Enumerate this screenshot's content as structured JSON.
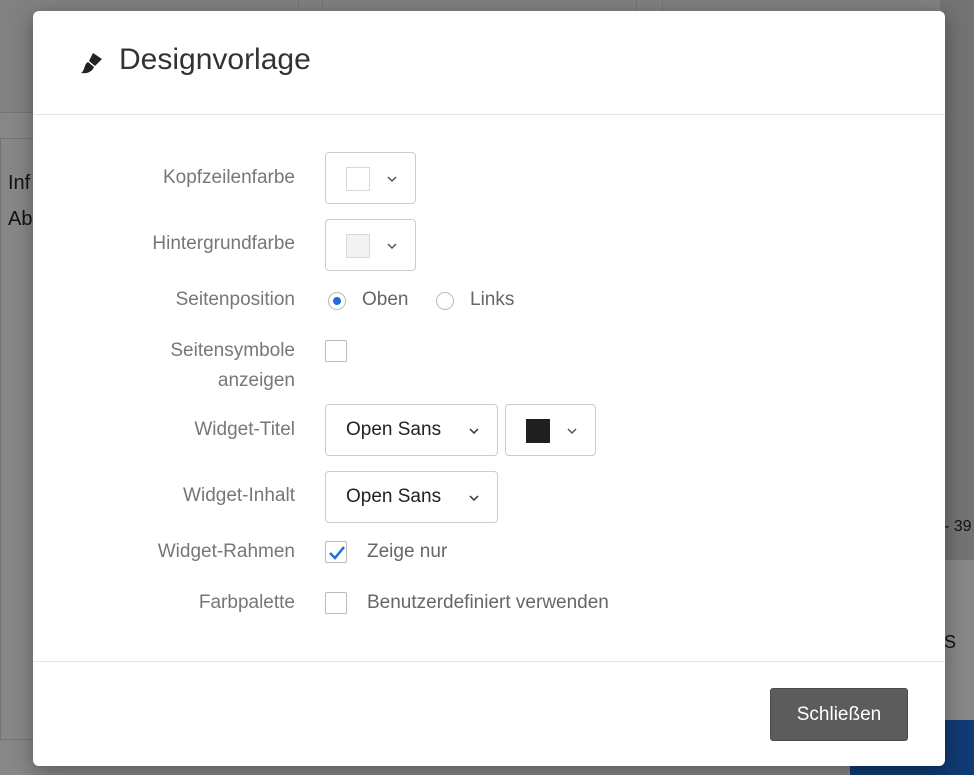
{
  "background": {
    "text_line_1": "Inf",
    "text_line_2": "Ab",
    "axis_fragment": "- 39",
    "icon_fragment": "S"
  },
  "modal": {
    "title": "Designvorlage",
    "icon": "brush-icon",
    "fields": {
      "header_color_label": "Kopfzeilenfarbe",
      "background_color_label": "Hintergrundfarbe",
      "page_position_label": "Seitenposition",
      "page_icons_label_1": "Seitensymbole",
      "page_icons_label_2": "anzeigen",
      "widget_title_label": "Widget-Titel",
      "widget_content_label": "Widget-Inhalt",
      "widget_frame_label": "Widget-Rahmen",
      "color_palette_label": "Farbpalette"
    },
    "values": {
      "header_color": "#ffffff",
      "background_color": "#f2f2f2",
      "page_position_options": [
        "Oben",
        "Links"
      ],
      "page_position_selected": "Oben",
      "page_icons_checked": false,
      "widget_title_font": "Open Sans",
      "widget_title_color": "#1f1f1f",
      "widget_content_font": "Open Sans",
      "widget_frame_option": "Zeige nur",
      "widget_frame_checked": true,
      "color_palette_option": "Benutzerdefiniert verwenden",
      "color_palette_checked": false
    },
    "close_label": "Schließen"
  },
  "colors": {
    "accent": "#1e6fd9",
    "close_button": "#5c5c5c"
  }
}
